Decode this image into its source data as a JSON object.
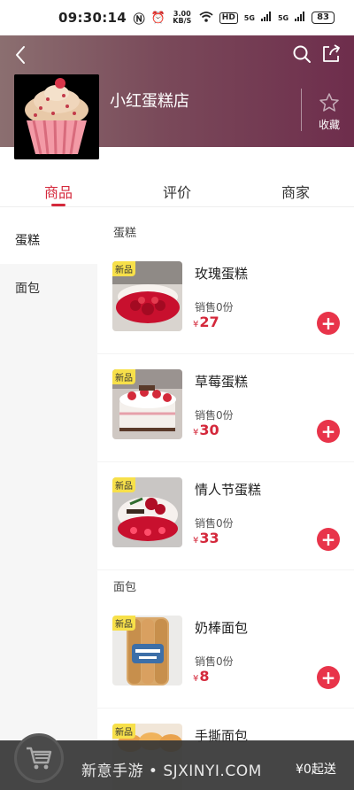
{
  "status_bar": {
    "time": "09:30:14",
    "network_speed": "3.00 KB/S",
    "hd_label": "HD",
    "signal_1": "5G",
    "signal_2": "5G",
    "battery": "83"
  },
  "header": {
    "shop_name": "小红蛋糕店",
    "favorite_label": "收藏"
  },
  "tabs": [
    {
      "label": "商品",
      "active": true
    },
    {
      "label": "评价",
      "active": false
    },
    {
      "label": "商家",
      "active": false
    }
  ],
  "sidebar": {
    "items": [
      {
        "label": "蛋糕",
        "active": true
      },
      {
        "label": "面包",
        "active": false
      }
    ]
  },
  "sections": [
    {
      "title": "蛋糕",
      "products": [
        {
          "tag": "新品",
          "name": "玫瑰蛋糕",
          "sales": "销售0份",
          "currency": "¥",
          "price": "27"
        },
        {
          "tag": "新品",
          "name": "草莓蛋糕",
          "sales": "销售0份",
          "currency": "¥",
          "price": "30"
        },
        {
          "tag": "新品",
          "name": "情人节蛋糕",
          "sales": "销售0份",
          "currency": "¥",
          "price": "33"
        }
      ]
    },
    {
      "title": "面包",
      "products": [
        {
          "tag": "新品",
          "name": "奶棒面包",
          "sales": "销售0份",
          "currency": "¥",
          "price": "8"
        },
        {
          "tag": "新品",
          "name": "手撕面包",
          "sales": "",
          "currency": "",
          "price": ""
        }
      ]
    }
  ],
  "bottom_bar": {
    "watermark": "新意手游 • SJXINYI.COM",
    "min_order": "¥0起送"
  },
  "colors": {
    "accent": "#d4283b",
    "add_button": "#e8344a",
    "new_tag": "#f7e04a",
    "header_left": "#8b6f70",
    "header_right": "#6e2d4c"
  }
}
